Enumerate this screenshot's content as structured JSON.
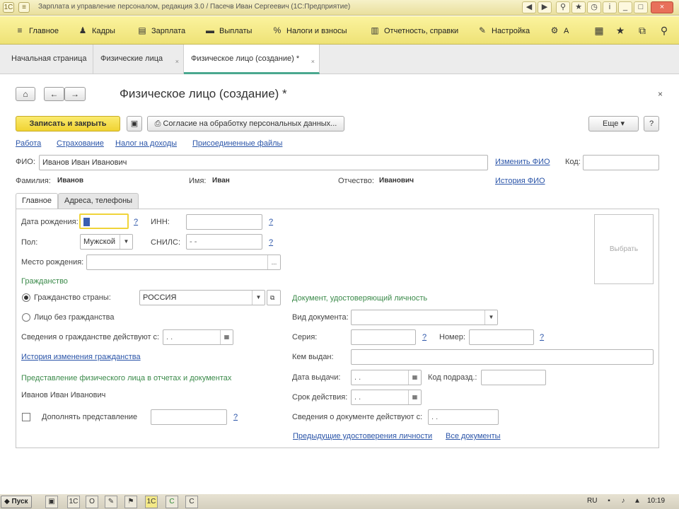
{
  "window": {
    "title": "Зарплата и управление персоналом, редакция 3.0 / Пасечв Иван Сергеевич (1С:Предприятие)",
    "controls": [
      "_",
      "□",
      "×"
    ]
  },
  "sections": {
    "items": [
      {
        "label": "Главное",
        "icon": "≡"
      },
      {
        "label": "Кадры",
        "icon": "♟"
      },
      {
        "label": "Зарплата",
        "icon": "▤"
      },
      {
        "label": "Выплаты",
        "icon": "▬"
      },
      {
        "label": "Налоги и взносы",
        "icon": "%"
      },
      {
        "label": "Отчетность, справки",
        "icon": "▥"
      },
      {
        "label": "Настройка",
        "icon": "✎"
      },
      {
        "label": "А",
        "icon": "⚙"
      }
    ],
    "tools": [
      "▦",
      "★",
      "⧉",
      "⚲"
    ]
  },
  "open_tabs": [
    {
      "label": "Начальная страница"
    },
    {
      "label": "Физические лица",
      "close": "×"
    },
    {
      "label": "Физическое лицо (создание) *",
      "close": "×"
    }
  ],
  "form": {
    "nav": {
      "home": "⌂",
      "back": "←",
      "forward": "→"
    },
    "title": "Физическое лицо (создание) *",
    "close": "×",
    "buttons": {
      "save_close": "Записать и закрыть",
      "save_icon": "▣",
      "consent": "Согласие на обработку персональных данных...",
      "more": "Еще",
      "more_arrow": "▾",
      "help": "?"
    },
    "links": [
      "Работа",
      "Страхование",
      "Налог на доходы",
      "Присоединенные файлы"
    ],
    "fio_label": "ФИО:",
    "fio_value": "Иванов Иван Иванович",
    "change_fio": "Изменить ФИО",
    "code_label": "Код:",
    "code_value": "",
    "surname_label": "Фамилия:",
    "surname_value": "Иванов",
    "name_label": "Имя:",
    "name_value": "Иван",
    "patronymic_label": "Отчество:",
    "patronymic_value": "Иванович",
    "fio_history": "История ФИО"
  },
  "tabs": [
    {
      "label": "Главное"
    },
    {
      "label": "Адреса, телефоны"
    }
  ],
  "main": {
    "birth_date_label": "Дата рождения:",
    "birth_date_value": "  .  .    ",
    "inn_label": "ИНН:",
    "inn_value": "",
    "sex_label": "Пол:",
    "sex_value": "Мужской",
    "snils_label": "СНИЛС:",
    "snils_value": "  -   -   ",
    "birthplace_label": "Место рождения:",
    "birthplace_value": "",
    "ellipsis": "...",
    "help": "?",
    "citizenship_header": "Гражданство",
    "citizen_of_label": "Гражданство страны:",
    "country_value": "РОССИЯ",
    "stateless_label": "Лицо без гражданства",
    "citizenship_valid_label": "Сведения о гражданстве действуют с:",
    "citizenship_valid_value": "  .  .    ",
    "citizenship_history": "История изменения гражданства",
    "representation_header": "Представление физического лица в отчетах и документах",
    "representation_value": "Иванов Иван Иванович",
    "extend_label": "Дополнять представление",
    "extend_value": "",
    "photo_label": "Выбрать",
    "identity_header": "Документ, удостоверяющий личность",
    "doc_type_label": "Вид документа:",
    "doc_type_value": "",
    "series_label": "Серия:",
    "series_value": "",
    "number_label": "Номер:",
    "number_value": "",
    "issued_by_label": "Кем выдан:",
    "issued_by_value": "",
    "issue_date_label": "Дата выдачи:",
    "issue_date_value": "  .  .    ",
    "dept_code_label": "Код подразд.:",
    "dept_code_value": "",
    "valid_until_label": "Срок действия:",
    "valid_until_value": "  .  .    ",
    "doc_valid_label": "Сведения о документе действуют с:",
    "doc_valid_value": "  .  .    ",
    "prev_docs": "Предыдущие удостоверения личности",
    "all_docs": "Все документы"
  },
  "taskbar": {
    "start": "Пуск",
    "lang": "RU",
    "clock": "10:19"
  },
  "colors": {
    "section_bar": "#f3e887",
    "primary_button": "#f4dc48",
    "link": "#2a54a8",
    "group_header": "#3b8a4a",
    "active_tab_underline": "#4aa88f"
  }
}
